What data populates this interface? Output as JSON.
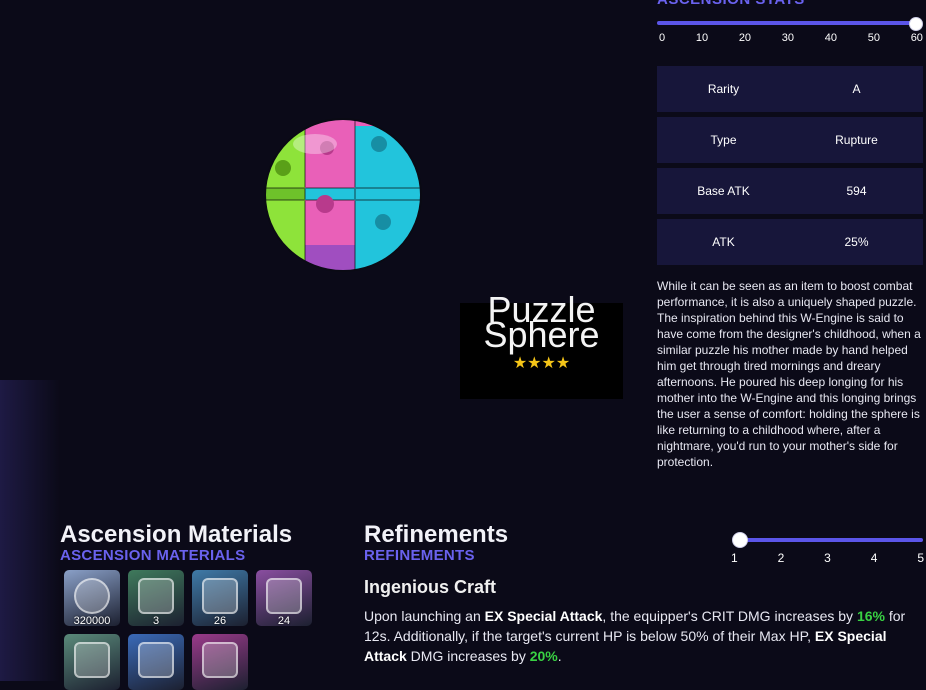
{
  "ascension_stats": {
    "title": "ASCENSION STATS",
    "level_ticks": [
      "0",
      "10",
      "20",
      "30",
      "40",
      "50",
      "60"
    ],
    "current_level": "60"
  },
  "stats": [
    {
      "label": "Rarity",
      "value": "A"
    },
    {
      "label": "Type",
      "value": "Rupture"
    },
    {
      "label": "Base ATK",
      "value": "594"
    },
    {
      "label": "ATK",
      "value": "25%"
    }
  ],
  "description": "While it can be seen as an item to boost combat performance, it is also a uniquely shaped puzzle. The inspiration behind this W-Engine is said to have come from the designer's childhood, when a similar puzzle his mother made by hand helped him get through tired mornings and dreary afternoons. He poured his deep longing for his mother into the W-Engine and this longing brings the user a sense of comfort: holding the sphere is like returning to a childhood where, after a nightmare, you'd run to your mother's side for protection.",
  "weapon": {
    "name_line1": "Puzzle",
    "name_line2": "Sphere",
    "stars": "★★★★"
  },
  "ascension_materials": {
    "title": "Ascension Materials",
    "subtitle": "ASCENSION MATERIALS",
    "items": [
      {
        "icon": "dennies-coin-icon",
        "count": "320000",
        "color": "#8aa0c8"
      },
      {
        "icon": "green-note-chip-icon",
        "count": "3",
        "color": "#3f7a5c"
      },
      {
        "icon": "blue-note-chip-icon",
        "count": "26",
        "color": "#3f7aa8"
      },
      {
        "icon": "pink-note-chip-icon",
        "count": "24",
        "color": "#8a4ea0"
      },
      {
        "icon": "green-drive-icon",
        "count": "",
        "color": "#5a8a7a"
      },
      {
        "icon": "blue-drive-icon",
        "count": "",
        "color": "#3a6ab8"
      },
      {
        "icon": "pink-drive-icon",
        "count": "",
        "color": "#9a3a8a"
      }
    ]
  },
  "refinements": {
    "title": "Refinements",
    "subtitle": "REFINEMENTS",
    "level_ticks": [
      "1",
      "2",
      "3",
      "4",
      "5"
    ],
    "current_level": "1",
    "skill_name": "Ingenious Craft",
    "text": {
      "p1": "Upon launching an ",
      "b1": "EX Special Attack",
      "p2": ", the equipper's CRIT DMG increases by ",
      "v1": "16%",
      "p3": " for 12s. Additionally, if the target's current HP is below 50% of their Max HP, ",
      "b2": "EX Special Attack",
      "p4": " DMG increases by ",
      "v2": "20%",
      "p5": "."
    }
  },
  "colors": {
    "accent": "#5b55e8",
    "panel": "#17163a",
    "highlight": "#39d143",
    "star": "#f5c518"
  }
}
